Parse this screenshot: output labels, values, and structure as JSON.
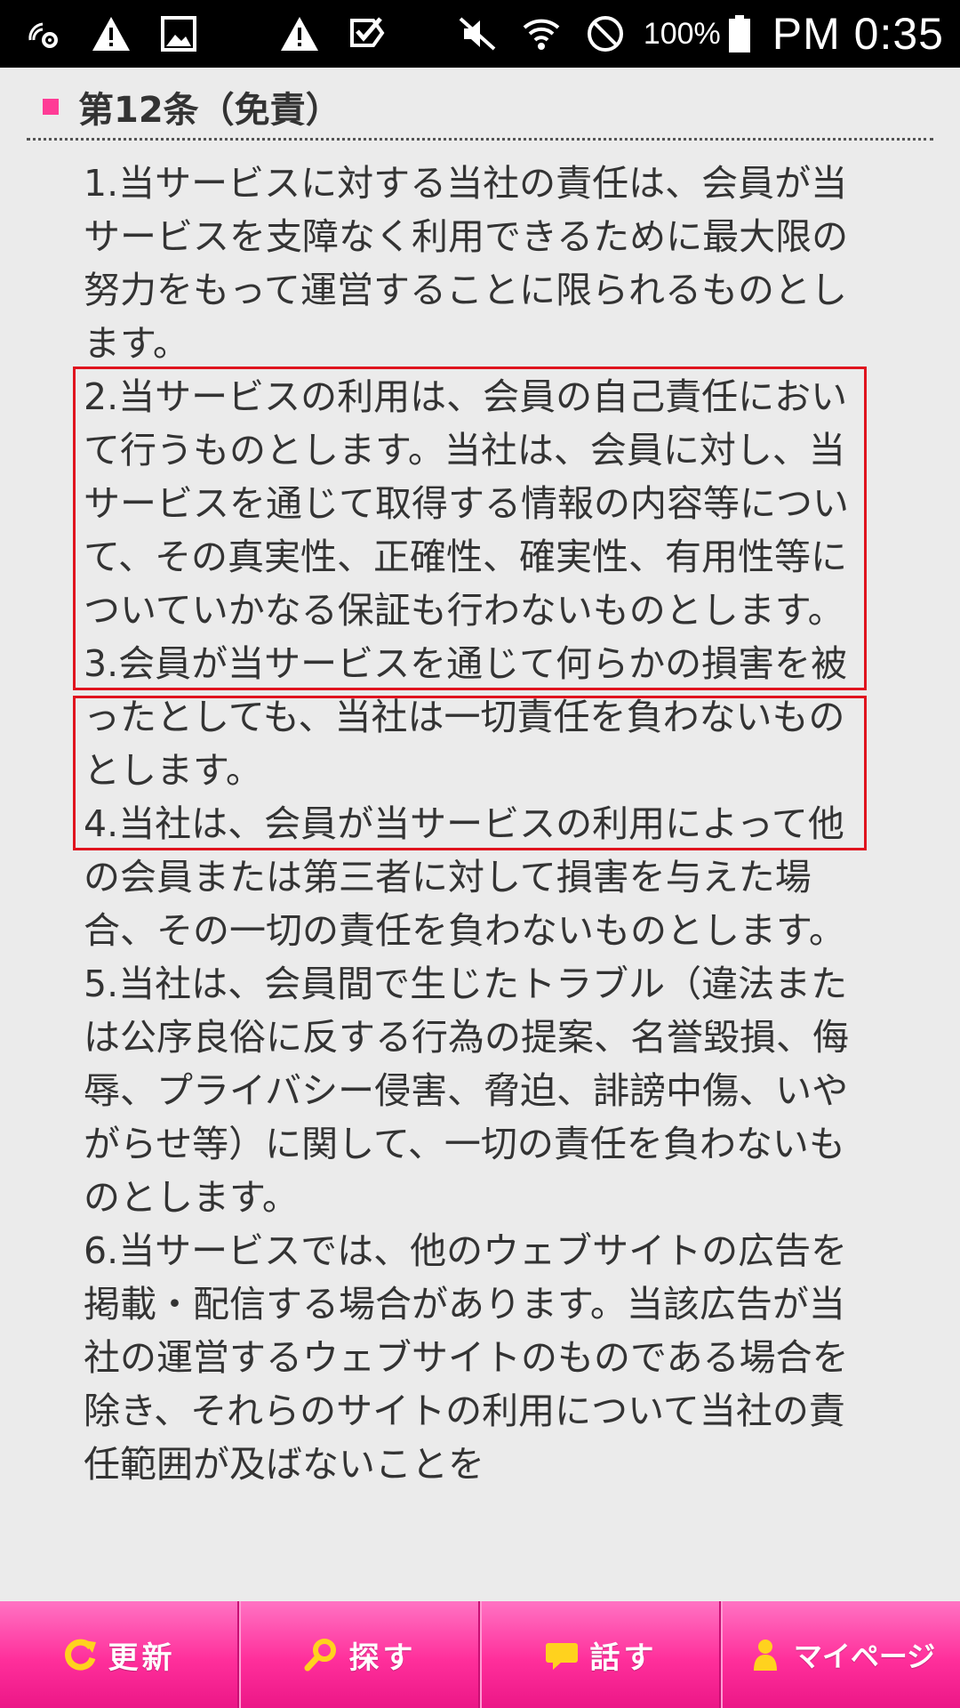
{
  "status_bar": {
    "icons_left": [
      "nfc-gear-icon",
      "warning-icon",
      "image-icon",
      "warning-icon",
      "checkmark-icon"
    ],
    "icons_right": [
      "mute-icon",
      "wifi-icon",
      "no-sim-icon"
    ],
    "battery_percent": "100%",
    "battery_icon": "battery-icon",
    "time": "PM 0:35"
  },
  "article": {
    "heading": "第12条（免責）",
    "accent_color": "#ff3c96",
    "clauses": [
      "1.当サービスに対する当社の責任は、会員が当サービスを支障なく利用できるために最大限の努力をもって運営することに限られるものとします。",
      "2.当サービスの利用は、会員の自己責任において行うものとします。当社は、会員に対し、当サービスを通じて取得する情報の内容等について、その真実性、正確性、確実性、有用性等についていかなる保証も行わないものとします。",
      "3.会員が当サービスを通じて何らかの損害を被ったとしても、当社は一切責任を負わないものとします。",
      "4.当社は、会員が当サービスの利用によって他の会員または第三者に対して損害を与えた場合、その一切の責任を負わないものとします。",
      "5.当社は、会員間で生じたトラブル（違法または公序良俗に反する行為の提案、名誉毀損、侮辱、プライバシー侵害、脅迫、誹謗中傷、いやがらせ等）に関して、一切の責任を負わないものとします。",
      "6.当サービスでは、他のウェブサイトの広告を掲載・配信する場合があります。当該広告が当社の運営するウェブサイトのものである場合を除き、それらのサイトの利用について当社の責任範囲が及ばないことを"
    ],
    "highlight_color": "#e0141e"
  },
  "bottom_nav": {
    "refresh": {
      "label": "更新",
      "icon": "refresh-icon"
    },
    "search": {
      "label": "探す",
      "icon": "search-icon"
    },
    "talk": {
      "label": "話す",
      "icon": "chat-icon"
    },
    "mypage": {
      "label": "マイページ",
      "icon": "person-icon"
    },
    "icon_color": "#ffd21e"
  }
}
